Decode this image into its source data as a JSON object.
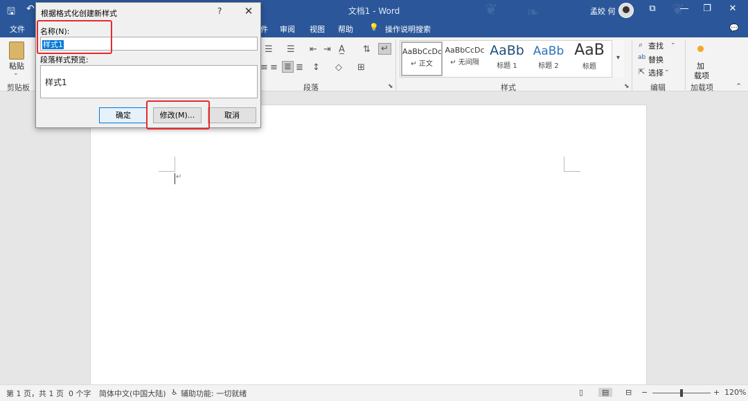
{
  "titlebar": {
    "doc_title": "文档1 - Word",
    "user_name": "孟姣 何",
    "save_glyph": "🖫",
    "undo_glyph": "↶",
    "win_icons": [
      "⧉",
      "—",
      "❐",
      "✕"
    ]
  },
  "menubar": {
    "items": [
      "文件",
      "件",
      "审阅",
      "视图",
      "帮助"
    ],
    "tell_me": "操作说明搜索",
    "bulb_glyph": "💡",
    "comment_glyph": "💬"
  },
  "ribbon": {
    "clipboard": {
      "paste_label": "粘贴",
      "group": "剪贴板"
    },
    "paragraph": {
      "group": "段落"
    },
    "styles": {
      "group": "样式",
      "items": [
        {
          "sample": "AaBbCcDc",
          "name": "↵ 正文"
        },
        {
          "sample": "AaBbCcDc",
          "name": "↵ 无间隔"
        },
        {
          "sample": "AaBb",
          "name": "标题 1"
        },
        {
          "sample": "AaBb",
          "name": "标题 2"
        },
        {
          "sample": "AaB",
          "name": "标题"
        }
      ]
    },
    "editing": {
      "find": "查找",
      "replace": "替换",
      "select": "选择",
      "group": "编辑"
    },
    "addins": {
      "label_line1": "加",
      "label_line2": "载项",
      "group": "加载项"
    }
  },
  "dialog": {
    "title": "根据格式化创建新样式",
    "help": "?",
    "close": "✕",
    "name_label": "名称(N):",
    "name_value": "样式1",
    "preview_label": "段落样式预览:",
    "preview_text": "样式1",
    "ok": "确定",
    "modify": "修改(M)...",
    "cancel": "取消"
  },
  "statusbar": {
    "page": "第 1 页，共 1 页",
    "words": "0 个字",
    "language": "简体中文(中国大陆)",
    "accessibility": "辅助功能: 一切就绪",
    "zoom": "120%"
  },
  "colors": {
    "titlebar": "#2b579a",
    "highlight": "#e8292c",
    "selection": "#0078d7"
  }
}
